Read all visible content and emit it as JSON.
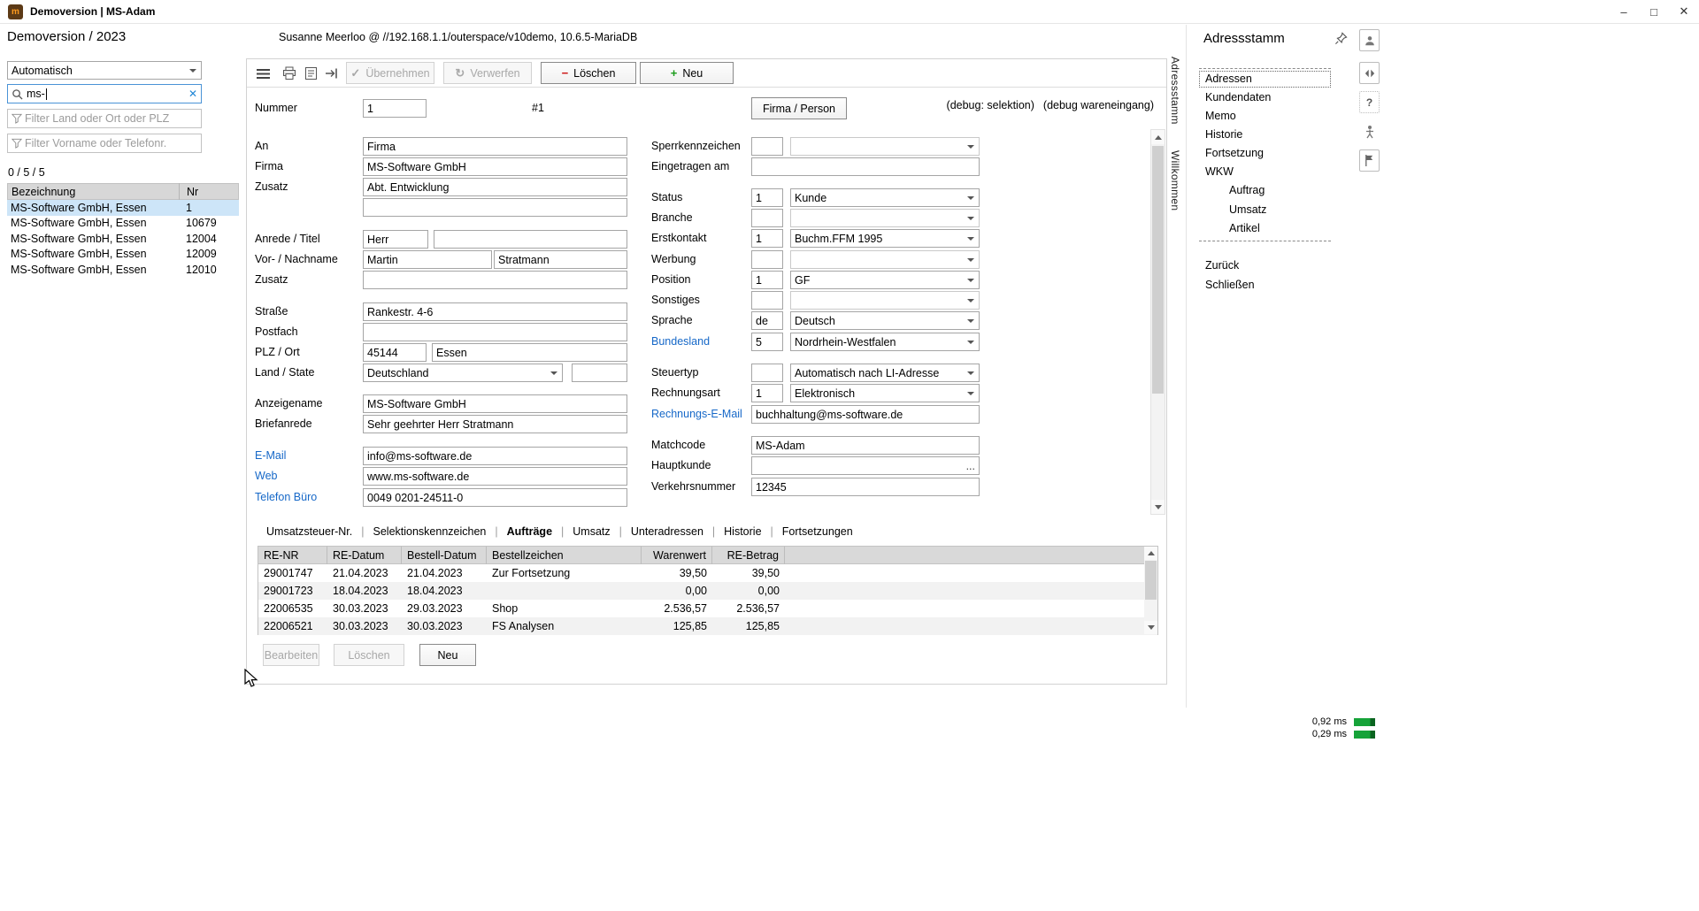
{
  "icons": {
    "minimize": "–",
    "maximize": "□",
    "close": "✕",
    "clear": "✕",
    "check": "✓",
    "discard": "↻",
    "minus": "−",
    "plus": "+",
    "help": "?",
    "tab_divider": "|",
    "logo": "m"
  },
  "window": {
    "title": "Demoversion | MS-Adam"
  },
  "header": {
    "left": "Demoversion / 2023",
    "center": "Susanne Meerloo @ //192.168.1.1/outerspace/v10demo, 10.6.5-MariaDB"
  },
  "sidebar": {
    "mode": "Automatisch",
    "search_value": "ms-",
    "filter_location": "Filter Land oder Ort oder PLZ",
    "filter_person": "Filter Vorname oder Telefonr.",
    "count": "0 / 5 / 5",
    "col_name": "Bezeichnung",
    "col_nr": "Nr",
    "rows": [
      {
        "name": "MS-Software GmbH, Essen",
        "nr": "1"
      },
      {
        "name": "MS-Software GmbH, Essen",
        "nr": "10679"
      },
      {
        "name": "MS-Software GmbH, Essen",
        "nr": "12004"
      },
      {
        "name": "MS-Software GmbH, Essen",
        "nr": "12009"
      },
      {
        "name": "MS-Software GmbH, Essen",
        "nr": "12010"
      }
    ]
  },
  "toolbar": {
    "apply": "Übernehmen",
    "discard": "Verwerfen",
    "delete": "Löschen",
    "new": "Neu"
  },
  "form": {
    "labels": {
      "nummer": "Nummer",
      "an": "An",
      "firma": "Firma",
      "zusatz": "Zusatz",
      "anrede": "Anrede / Titel",
      "name": "Vor- / Nachname",
      "zusatz2": "Zusatz",
      "strasse": "Straße",
      "postfach": "Postfach",
      "plzort": "PLZ / Ort",
      "land": "Land / State",
      "anzeigename": "Anzeigename",
      "briefanrede": "Briefanrede",
      "email": "E-Mail",
      "web": "Web",
      "telefon": "Telefon Büro",
      "sperr": "Sperrkennzeichen",
      "eingetragen": "Eingetragen am",
      "status": "Status",
      "branche": "Branche",
      "erstkontakt": "Erstkontakt",
      "werbung": "Werbung",
      "position": "Position",
      "sonstiges": "Sonstiges",
      "sprache": "Sprache",
      "bundesland": "Bundesland",
      "steuertyp": "Steuertyp",
      "rechnungsart": "Rechnungsart",
      "rechnungs_email": "Rechnungs-E-Mail",
      "matchcode": "Matchcode",
      "hauptkunde": "Hauptkunde",
      "verkehrsnummer": "Verkehrsnummer"
    },
    "values": {
      "nummer": "1",
      "nummer_hash": "#1",
      "an": "Firma",
      "firma": "MS-Software GmbH",
      "zusatz": "Abt. Entwicklung",
      "anrede": "Herr",
      "vorname": "Martin",
      "nachname": "Stratmann",
      "strasse": "Rankestr. 4-6",
      "plz": "45144",
      "ort": "Essen",
      "land": "Deutschland",
      "anzeigename": "MS-Software GmbH",
      "briefanrede": "Sehr geehrter Herr Stratmann",
      "email": "info@ms-software.de",
      "web": "www.ms-software.de",
      "telefon": "0049 0201-24511-0",
      "status_nr": "1",
      "status": "Kunde",
      "erstkontakt_nr": "1",
      "erstkontakt": "Buchm.FFM 1995",
      "position_nr": "1",
      "position": "GF",
      "sprache_code": "de",
      "sprache": "Deutsch",
      "bundesland_nr": "5",
      "bundesland": "Nordrhein-Westfalen",
      "steuertyp": "Automatisch nach LI-Adresse",
      "rechnungsart_nr": "1",
      "rechnungsart": "Elektronisch",
      "rechnungs_email": "buchhaltung@ms-software.de",
      "matchcode": "MS-Adam",
      "verkehrsnummer": "12345"
    },
    "buttons": {
      "firma_person": "Firma / Person",
      "hauptkunde_more": "..."
    },
    "debug": {
      "selektion": "(debug: selektion)",
      "wareneingang": "(debug wareneingang)"
    }
  },
  "bottom": {
    "tabs": [
      "Umsatzsteuer-Nr.",
      "Selektionskennzeichen",
      "Aufträge",
      "Umsatz",
      "Unteradressen",
      "Historie",
      "Fortsetzungen"
    ],
    "orders_headers": [
      "RE-NR",
      "RE-Datum",
      "Bestell-Datum",
      "Bestellzeichen",
      "Warenwert",
      "RE-Betrag"
    ],
    "orders": [
      [
        "29001747",
        "21.04.2023",
        "21.04.2023",
        "Zur Fortsetzung",
        "39,50",
        "39,50"
      ],
      [
        "29001723",
        "18.04.2023",
        "18.04.2023",
        "",
        "0,00",
        "0,00"
      ],
      [
        "22006535",
        "30.03.2023",
        "29.03.2023",
        "Shop",
        "2.536,57",
        "2.536,57"
      ],
      [
        "22006521",
        "30.03.2023",
        "30.03.2023",
        "FS Analysen",
        "125,85",
        "125,85"
      ]
    ],
    "buttons": {
      "edit": "Bearbeiten",
      "delete": "Löschen",
      "new": "Neu"
    }
  },
  "side_tabs": {
    "adressstamm": "Adressstamm",
    "willkommen": "Willkommen"
  },
  "right_panel": {
    "title": "Adressstamm",
    "items": [
      {
        "label": "Adressen"
      },
      {
        "label": "Kundendaten"
      },
      {
        "label": "Memo"
      },
      {
        "label": "Historie"
      },
      {
        "label": "Fortsetzung"
      },
      {
        "label": "WKW"
      },
      {
        "label": "Auftrag"
      },
      {
        "label": "Umsatz"
      },
      {
        "label": "Artikel"
      }
    ],
    "back": "Zurück",
    "close": "Schließen"
  },
  "status": {
    "t1": "0,92 ms",
    "t2": "0,29 ms"
  }
}
